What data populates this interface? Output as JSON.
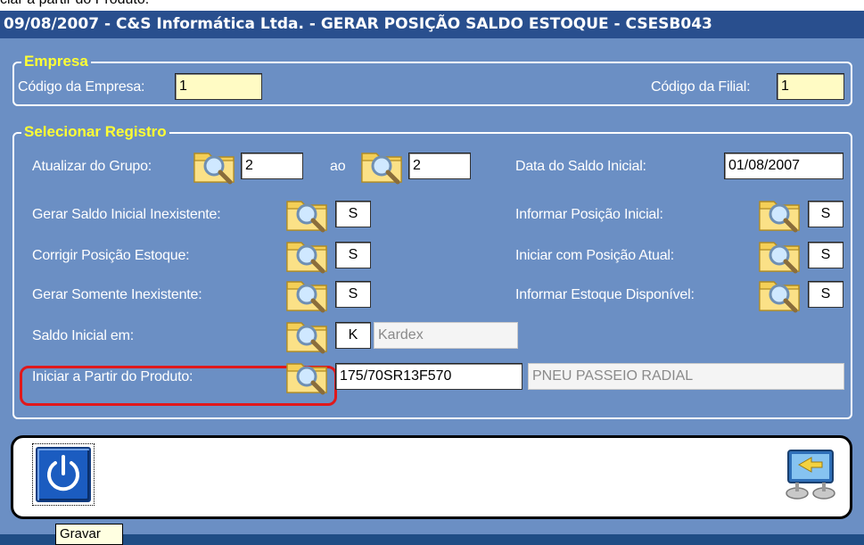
{
  "caption": "ciar a partir do Produto.",
  "titlebar": {
    "title": "09/08/2007 - C&S Informática Ltda. - GERAR POSIÇÃO SALDO ESTOQUE - CSESB043"
  },
  "empresa": {
    "legend": "Empresa",
    "codigo_empresa_label": "Código da Empresa:",
    "codigo_empresa_value": "1",
    "codigo_filial_label": "Código da Filial:",
    "codigo_filial_value": "1"
  },
  "selecionar": {
    "legend": "Selecionar Registro",
    "atualizar_label": "Atualizar do Grupo:",
    "grupo_de": "2",
    "ao_label": "ao",
    "grupo_ate": "2",
    "data_label": "Data do Saldo Inicial:",
    "data_value": "01/08/2007",
    "gerar_saldo_label": "Gerar Saldo Inicial Inexistente:",
    "gerar_saldo_value": "S",
    "informar_posicao_label": "Informar Posição Inicial:",
    "informar_posicao_value": "S",
    "corrigir_label": "Corrigir Posição Estoque:",
    "corrigir_value": "S",
    "iniciar_atual_label": "Iniciar com Posição Atual:",
    "iniciar_atual_value": "S",
    "gerar_somente_label": "Gerar Somente Inexistente:",
    "gerar_somente_value": "S",
    "informar_estoque_label": "Informar Estoque Disponível:",
    "informar_estoque_value": "S",
    "saldo_inicial_label": "Saldo Inicial em:",
    "saldo_inicial_code": "K",
    "saldo_inicial_desc": "Kardex",
    "produto_label": "Iniciar a Partir do Produto:",
    "produto_code": "175/70SR13F570",
    "produto_desc": "PNEU PASSEIO RADIAL"
  },
  "tooltip": "Gravar",
  "colors": {
    "window_bg": "#6b8fc4",
    "titlebar_bg": "#294f8e",
    "legend": "#ffff33",
    "highlight": "#e0181b"
  }
}
